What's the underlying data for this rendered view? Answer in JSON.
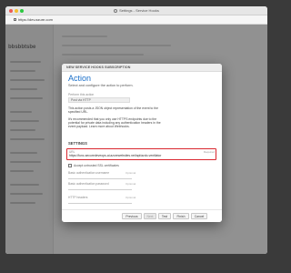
{
  "window": {
    "title": "Settings - Service Hooks"
  },
  "browser": {
    "url": "https://dev.azure.com"
  },
  "background": {
    "sidebar_heading": "bbsbbtsbe"
  },
  "dialog": {
    "header": "NEW SERVICE HOOKS SUBSCRIPTION",
    "title": "Action",
    "subtitle": "Select and configure the action to perform.",
    "perform_label": "Perform this action",
    "perform_value": "Post via HTTP",
    "description_1": "This action posts a JSON object representation of the event to the specified URL.",
    "description_2": "It's recommended that you only use HTTPS endpoints due to the potential for private data including any authentication headers in the event payload. Learn more about Webhooks.",
    "settings_heading": "SETTINGS",
    "url_label": "URL",
    "url_required": "Required",
    "url_value": "https://func-securedeveops-ai.azurewebsites.net/api/azdo-ventilator",
    "checkbox_label": "Accept untrusted SSL certificates",
    "basic_user_label": "Basic authentication username",
    "basic_pass_label": "Basic authentication password",
    "http_headers_label": "HTTP headers",
    "optional": "Optional"
  },
  "footer": {
    "previous": "Previous",
    "next": "Next",
    "test": "Test",
    "finish": "Finish",
    "cancel": "Cancel"
  },
  "colors": {
    "accent": "#1a6fc9",
    "highlight": "#d9262e"
  }
}
